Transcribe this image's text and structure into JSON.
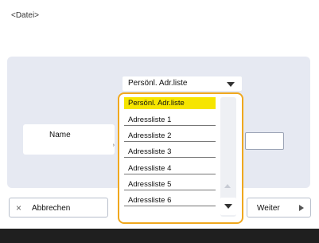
{
  "breadcrumb": "<Datei>",
  "list_select": {
    "selected": "Persönl. Adr.liste"
  },
  "name_button": {
    "label": "Name",
    "arrow": "›"
  },
  "dropdown": {
    "options": [
      "Persönl. Adr.liste",
      "Adressliste 1",
      "Adressliste 2",
      "Adressliste 3",
      "Adressliste 4",
      "Adressliste 5",
      "Adressliste 6"
    ],
    "selected_index": 0
  },
  "buttons": {
    "cancel": "Abbrechen",
    "cancel_icon": "×",
    "next": "Weiter"
  },
  "colors": {
    "highlight": "#f6e500",
    "dropdown_border": "#f0a81e",
    "panel": "#e6e9f2"
  }
}
